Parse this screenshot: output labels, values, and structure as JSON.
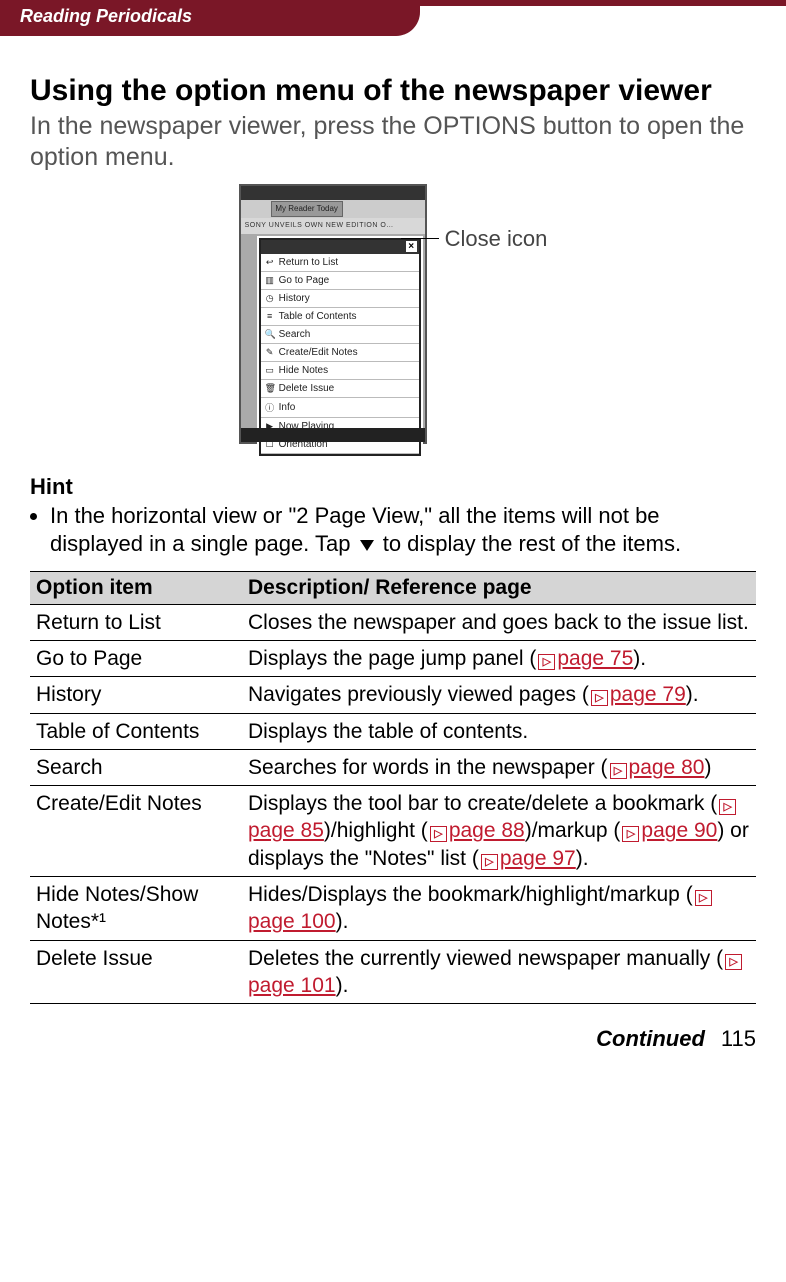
{
  "header": {
    "section_title": "Reading Periodicals"
  },
  "main": {
    "heading": "Using the option menu of the newspaper viewer",
    "intro": "In the newspaper viewer, press the OPTIONS button to open the option menu."
  },
  "figure": {
    "callout_label": "Close icon",
    "tab_label": "My Reader Today",
    "headline": "SONY UNVEILS OWN NEW EDITION O…",
    "menu_items": [
      {
        "icon": "↩",
        "label": "Return to List"
      },
      {
        "icon": "▥",
        "label": "Go to Page"
      },
      {
        "icon": "◷",
        "label": "History"
      },
      {
        "icon": "≡",
        "label": "Table of Contents"
      },
      {
        "icon": "🔍",
        "label": "Search"
      },
      {
        "icon": "✎",
        "label": "Create/Edit Notes"
      },
      {
        "icon": "▭",
        "label": "Hide Notes"
      },
      {
        "icon": "🗑",
        "label": "Delete Issue"
      },
      {
        "icon": "ⓘ",
        "label": "Info"
      },
      {
        "icon": "▶",
        "label": "Now Playing"
      },
      {
        "icon": "☐",
        "label": "Orientation"
      }
    ]
  },
  "hint": {
    "heading": "Hint",
    "text_before": "In the horizontal view or \"2 Page View,\" all the items will not be displayed in a single page. Tap ",
    "text_after": " to display the rest of the items."
  },
  "table": {
    "headers": {
      "col1": "Option item",
      "col2": "Description/ Reference page"
    },
    "rows": [
      {
        "item": "Return to List",
        "desc_parts": [
          {
            "t": "text",
            "v": "Closes the newspaper and goes back to the issue list."
          }
        ]
      },
      {
        "item": "Go to Page",
        "desc_parts": [
          {
            "t": "text",
            "v": "Displays the page jump panel ("
          },
          {
            "t": "xref",
            "v": "page 75"
          },
          {
            "t": "text",
            "v": ")."
          }
        ]
      },
      {
        "item": "History",
        "desc_parts": [
          {
            "t": "text",
            "v": "Navigates previously viewed pages ("
          },
          {
            "t": "xref",
            "v": "page 79"
          },
          {
            "t": "text",
            "v": ")."
          }
        ]
      },
      {
        "item": "Table of Contents",
        "desc_parts": [
          {
            "t": "text",
            "v": "Displays the table of contents."
          }
        ]
      },
      {
        "item": "Search",
        "desc_parts": [
          {
            "t": "text",
            "v": "Searches for words in the newspaper ("
          },
          {
            "t": "xref",
            "v": "page 80"
          },
          {
            "t": "text",
            "v": ")"
          }
        ]
      },
      {
        "item": "Create/Edit Notes",
        "desc_parts": [
          {
            "t": "text",
            "v": "Displays the tool bar to create/delete a bookmark ("
          },
          {
            "t": "xref",
            "v": "page 85"
          },
          {
            "t": "text",
            "v": ")/highlight ("
          },
          {
            "t": "xref",
            "v": "page 88"
          },
          {
            "t": "text",
            "v": ")/markup ("
          },
          {
            "t": "xref",
            "v": "page 90"
          },
          {
            "t": "text",
            "v": ") or displays the \"Notes\" list ("
          },
          {
            "t": "xref",
            "v": "page 97"
          },
          {
            "t": "text",
            "v": ")."
          }
        ]
      },
      {
        "item": "Hide Notes/Show Notes*¹",
        "desc_parts": [
          {
            "t": "text",
            "v": "Hides/Displays the bookmark/highlight/markup ("
          },
          {
            "t": "xref",
            "v": "page 100"
          },
          {
            "t": "text",
            "v": ")."
          }
        ]
      },
      {
        "item": "Delete Issue",
        "desc_parts": [
          {
            "t": "text",
            "v": "Deletes the currently viewed newspaper manually ("
          },
          {
            "t": "xref",
            "v": "page 101"
          },
          {
            "t": "text",
            "v": ")."
          }
        ]
      }
    ]
  },
  "footer": {
    "continued": "Continued",
    "page_number": "115"
  }
}
